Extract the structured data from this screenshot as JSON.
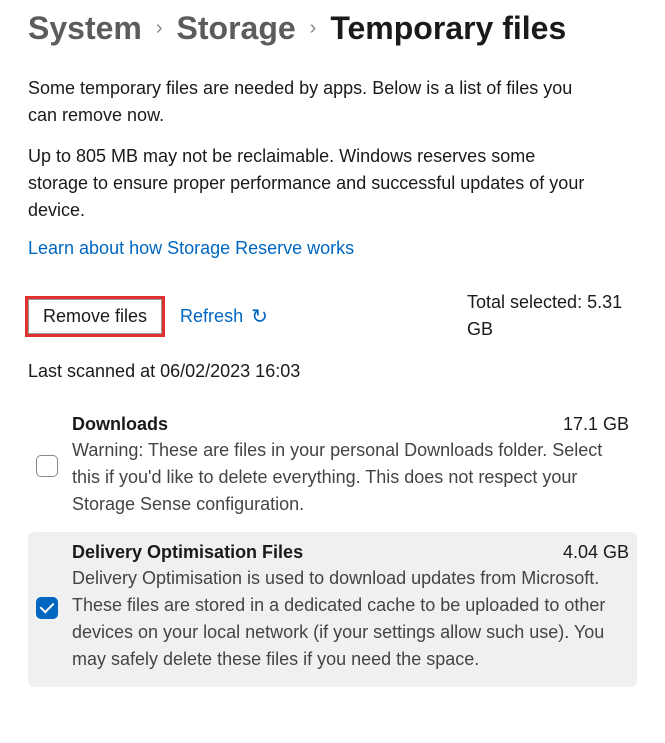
{
  "breadcrumb": {
    "items": [
      "System",
      "Storage",
      "Temporary files"
    ]
  },
  "intro1": "Some temporary files are needed by apps. Below is a list of files you can remove now.",
  "intro2": "Up to 805 MB may not be reclaimable. Windows reserves some storage to ensure proper performance and successful updates of your device.",
  "learn_link": "Learn about how Storage Reserve works",
  "actions": {
    "remove": "Remove files",
    "refresh": "Refresh"
  },
  "total_selected": "Total selected: 5.31 GB",
  "last_scanned": "Last scanned at 06/02/2023 16:03",
  "files": [
    {
      "title": "Downloads",
      "size": "17.1 GB",
      "desc": "Warning: These are files in your personal Downloads folder. Select this if you'd like to delete everything. This does not respect your Storage Sense configuration.",
      "checked": false
    },
    {
      "title": "Delivery Optimisation Files",
      "size": "4.04 GB",
      "desc": "Delivery Optimisation is used to download updates from Microsoft. These files are stored in a dedicated cache to be uploaded to other devices on your local network (if your settings allow such use). You may safely delete these files if you need the space.",
      "checked": true
    }
  ]
}
